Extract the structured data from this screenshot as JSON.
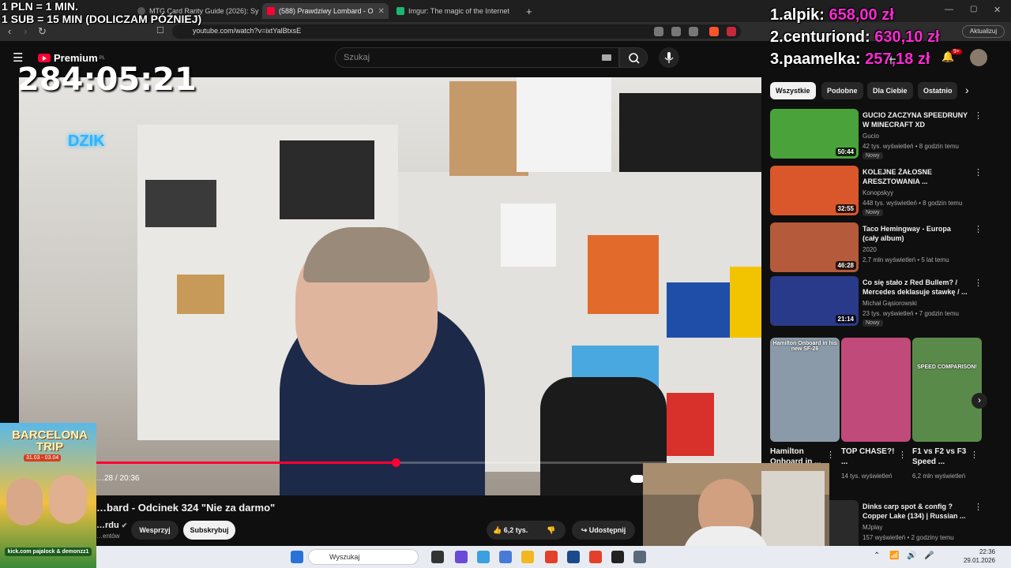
{
  "browser": {
    "tabs": [
      {
        "label": "MTG Card Rarity Guide (2026): Symb",
        "color": "#444"
      },
      {
        "label": "(588) Prawdziwy Lombard - O",
        "color": "#ff0033"
      },
      {
        "label": "Imgur: The magic of the Internet",
        "color": "#1bb76e"
      }
    ],
    "url": "youtube.com/watch?v=ixtYalBtxsE",
    "update_label": "Aktualizuj",
    "notification_count": "9+"
  },
  "youtube": {
    "logo_label": "Premium",
    "region": "PL",
    "search_placeholder": "Szukaj",
    "video": {
      "time": "…28 / 20:36",
      "progress": 0.45,
      "title": "…bard - Odcinek 324 \"Nie za darmo\"",
      "channel": "…rdu",
      "subs_suffix": "…entów",
      "support_label": "Wesprzyj",
      "subscribe_label": "Subskrybuj",
      "likes": "6,2 tys.",
      "share_label": "Udostępnij"
    },
    "chips": [
      "Wszystkie",
      "Podobne",
      "Dla Ciebie",
      "Ostatnio"
    ],
    "recommendations": [
      {
        "title": "GUCIO ZACZYNA SPEEDRUNY W MINECRAFT XD",
        "channel": "Gucio",
        "meta": "42 tys. wyświetleń • 8 godzin temu",
        "duration": "50:44",
        "badge": "Nowy",
        "color": "#4aa33a"
      },
      {
        "title": "KOLEJNE ŻAŁOSNE ARESZTOWANIA ...",
        "channel": "Konopskyy",
        "meta": "448 tys. wyświetleń • 8 godzin temu",
        "duration": "32:55",
        "badge": "Nowy",
        "color": "#d9572a"
      },
      {
        "title": "Taco Hemingway - Europa (cały album)",
        "channel": "2020",
        "meta": "2,7 mln wyświetleń • 5 lat temu",
        "duration": "46:28",
        "badge": "",
        "color": "#b55a3a"
      },
      {
        "title": "Co się stało z Red Bullem? / Mercedes deklasuje stawkę / ...",
        "channel": "Michał Gąsiorowski",
        "meta": "23 tys. wyświetleń • 7 godzin temu",
        "duration": "21:14",
        "badge": "Nowy",
        "color": "#2a3a8a"
      }
    ],
    "shorts": [
      {
        "title": "Hamilton Onboard in ...",
        "views": "",
        "caption": "Hamilton Onboard in his new SF-26",
        "color": "#8a9aa8"
      },
      {
        "title": "TOP CHASE?! ...",
        "views": "14 tys. wyświetleń",
        "caption": "",
        "color": "#c04a7a"
      },
      {
        "title": "F1 vs F2 vs F3 Speed ...",
        "views": "6,2 mln wyświetleń",
        "caption": "SPEED COMPARISON!",
        "color": "#5a8a4a"
      }
    ],
    "next_rec": {
      "title": "Dinks carp spot & config ? Copper Lake (134) | Russian ...",
      "channel": "MJplay",
      "meta": "157 wyświetleń • 2 godziny temu"
    }
  },
  "stream_overlay": {
    "rules": [
      "1 PLN = 1 MIN.",
      "1 SUB = 15 MIN (DOLICZAM PÓŹNIEJ)"
    ],
    "timer": "284:05:21",
    "donors": [
      {
        "rank": "1.",
        "name": "alpik:",
        "amount": "658,00 zł"
      },
      {
        "rank": "2.",
        "name": "centuriond:",
        "amount": "630,10 zł"
      },
      {
        "rank": "3.",
        "name": "paamelka:",
        "amount": "257,18 zł"
      }
    ],
    "promo": {
      "title": "BARCELONA TRIP",
      "dates": "31.03 - 03.04",
      "footer": "kick.com pajalock & demonzz1"
    },
    "sign_text": "DZIK"
  },
  "taskbar": {
    "search_placeholder": "Wyszukaj",
    "time": "22:36",
    "date": "29.01.2026"
  }
}
